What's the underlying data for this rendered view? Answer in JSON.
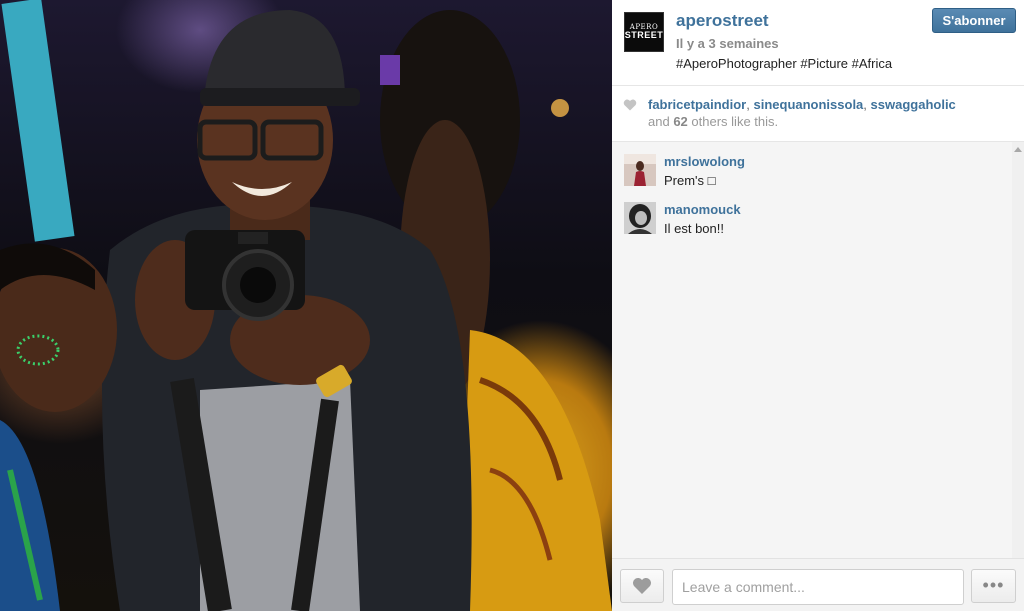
{
  "post": {
    "username": "aperostreet",
    "avatar_label_top": "APERO",
    "avatar_label_bottom": "STREET",
    "timestamp": "Il y a 3 semaines",
    "caption": "#AperoPhotographer #Picture #Africa",
    "follow_label": "S'abonner"
  },
  "likes": {
    "likers": [
      "fabricetpaindior",
      "sinequanonissola",
      "sswaggaholic"
    ],
    "others_prefix": "and",
    "others_count": "62",
    "others_suffix": "others like this."
  },
  "comments": [
    {
      "author": "mrslowolong",
      "text": "Prem's □"
    },
    {
      "author": "manomouck",
      "text": "Il est bon!!"
    }
  ],
  "footer": {
    "comment_placeholder": "Leave a comment...",
    "more_label": "•••"
  },
  "colors": {
    "link": "#3f729b",
    "follow_button": "#3f729b",
    "comments_bg": "#f5f5f5"
  },
  "icons": {
    "like": "heart-icon",
    "more": "ellipsis-icon"
  }
}
